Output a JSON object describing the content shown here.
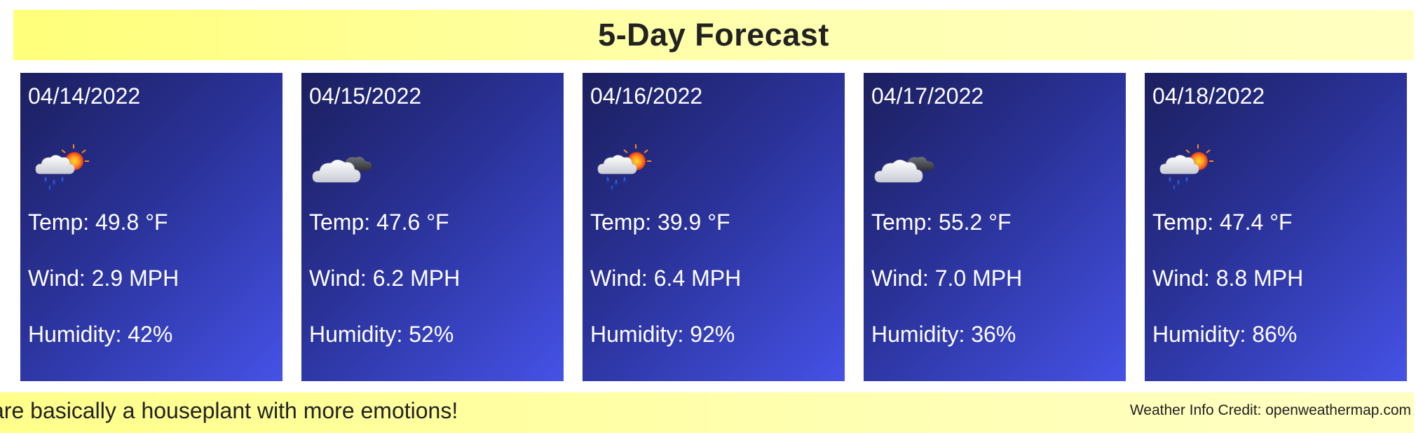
{
  "header": {
    "title": "5-Day Forecast"
  },
  "forecast": [
    {
      "date": "04/14/2022",
      "icon": "rain-sun-icon",
      "temp": "Temp: 49.8 °F",
      "wind": "Wind: 2.9 MPH",
      "humidity": "Humidity: 42%"
    },
    {
      "date": "04/15/2022",
      "icon": "broken-clouds-icon",
      "temp": "Temp: 47.6 °F",
      "wind": "Wind: 6.2 MPH",
      "humidity": "Humidity: 52%"
    },
    {
      "date": "04/16/2022",
      "icon": "rain-sun-icon",
      "temp": "Temp: 39.9 °F",
      "wind": "Wind: 6.4 MPH",
      "humidity": "Humidity: 92%"
    },
    {
      "date": "04/17/2022",
      "icon": "broken-clouds-icon",
      "temp": "Temp: 55.2 °F",
      "wind": "Wind: 7.0 MPH",
      "humidity": "Humidity: 36%"
    },
    {
      "date": "04/18/2022",
      "icon": "rain-sun-icon",
      "temp": "Temp: 47.4 °F",
      "wind": "Wind: 8.8 MPH",
      "humidity": "Humidity: 86%"
    }
  ],
  "footer": {
    "marquee": "are basically a houseplant with more emotions!",
    "credit": "Weather Info Credit: openweathermap.com"
  },
  "colors": {
    "header_yellow": "#ffff7a",
    "card_dark": "#1c1f5e",
    "card_light": "#4552e6",
    "text_dark": "#222222"
  }
}
